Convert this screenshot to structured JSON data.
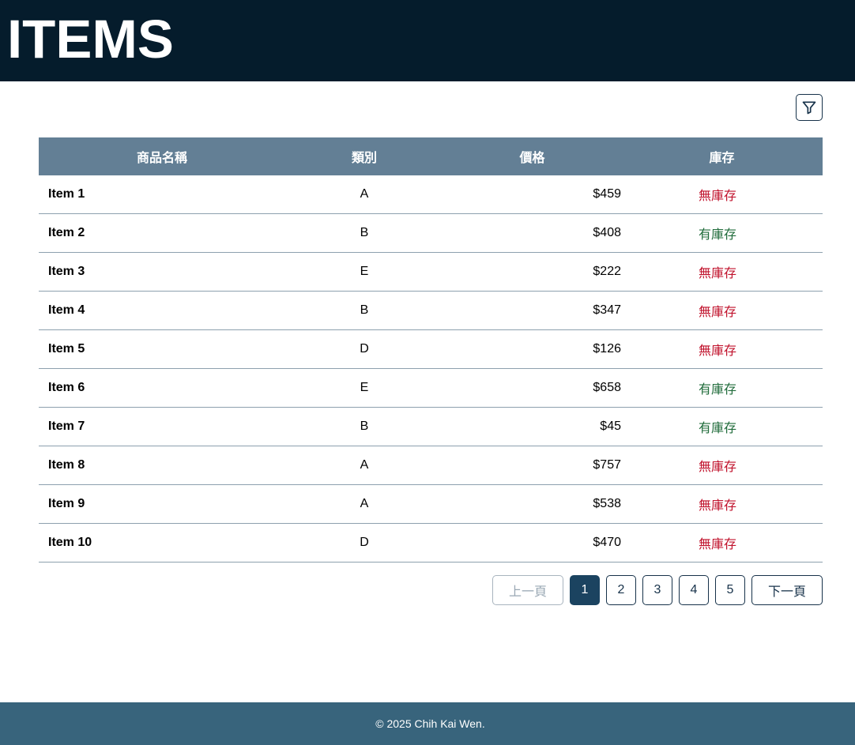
{
  "header": {
    "title": "ITEMS"
  },
  "toolbar": {
    "filter_icon": "filter-icon"
  },
  "table": {
    "columns": [
      "商品名稱",
      "類別",
      "價格",
      "庫存"
    ],
    "rows": [
      {
        "name": "Item 1",
        "category": "A",
        "price": "$459",
        "stock": "無庫存",
        "in_stock": false
      },
      {
        "name": "Item 2",
        "category": "B",
        "price": "$408",
        "stock": "有庫存",
        "in_stock": true
      },
      {
        "name": "Item 3",
        "category": "E",
        "price": "$222",
        "stock": "無庫存",
        "in_stock": false
      },
      {
        "name": "Item 4",
        "category": "B",
        "price": "$347",
        "stock": "無庫存",
        "in_stock": false
      },
      {
        "name": "Item 5",
        "category": "D",
        "price": "$126",
        "stock": "無庫存",
        "in_stock": false
      },
      {
        "name": "Item 6",
        "category": "E",
        "price": "$658",
        "stock": "有庫存",
        "in_stock": true
      },
      {
        "name": "Item 7",
        "category": "B",
        "price": "$45",
        "stock": "有庫存",
        "in_stock": true
      },
      {
        "name": "Item 8",
        "category": "A",
        "price": "$757",
        "stock": "無庫存",
        "in_stock": false
      },
      {
        "name": "Item 9",
        "category": "A",
        "price": "$538",
        "stock": "無庫存",
        "in_stock": false
      },
      {
        "name": "Item 10",
        "category": "D",
        "price": "$470",
        "stock": "無庫存",
        "in_stock": false
      }
    ]
  },
  "pagination": {
    "prev_label": "上一頁",
    "next_label": "下一頁",
    "pages": [
      "1",
      "2",
      "3",
      "4",
      "5"
    ],
    "current_page": 1,
    "prev_disabled": true
  },
  "footer": {
    "copyright": "© 2025 Chih Kai Wen."
  },
  "colors": {
    "header_bg": "#051c2c",
    "table_header_bg": "#637f95",
    "footer_bg": "#38647c",
    "stock_out": "#c0112b",
    "stock_in": "#1f6b3a",
    "active_page": "#1b4360"
  }
}
